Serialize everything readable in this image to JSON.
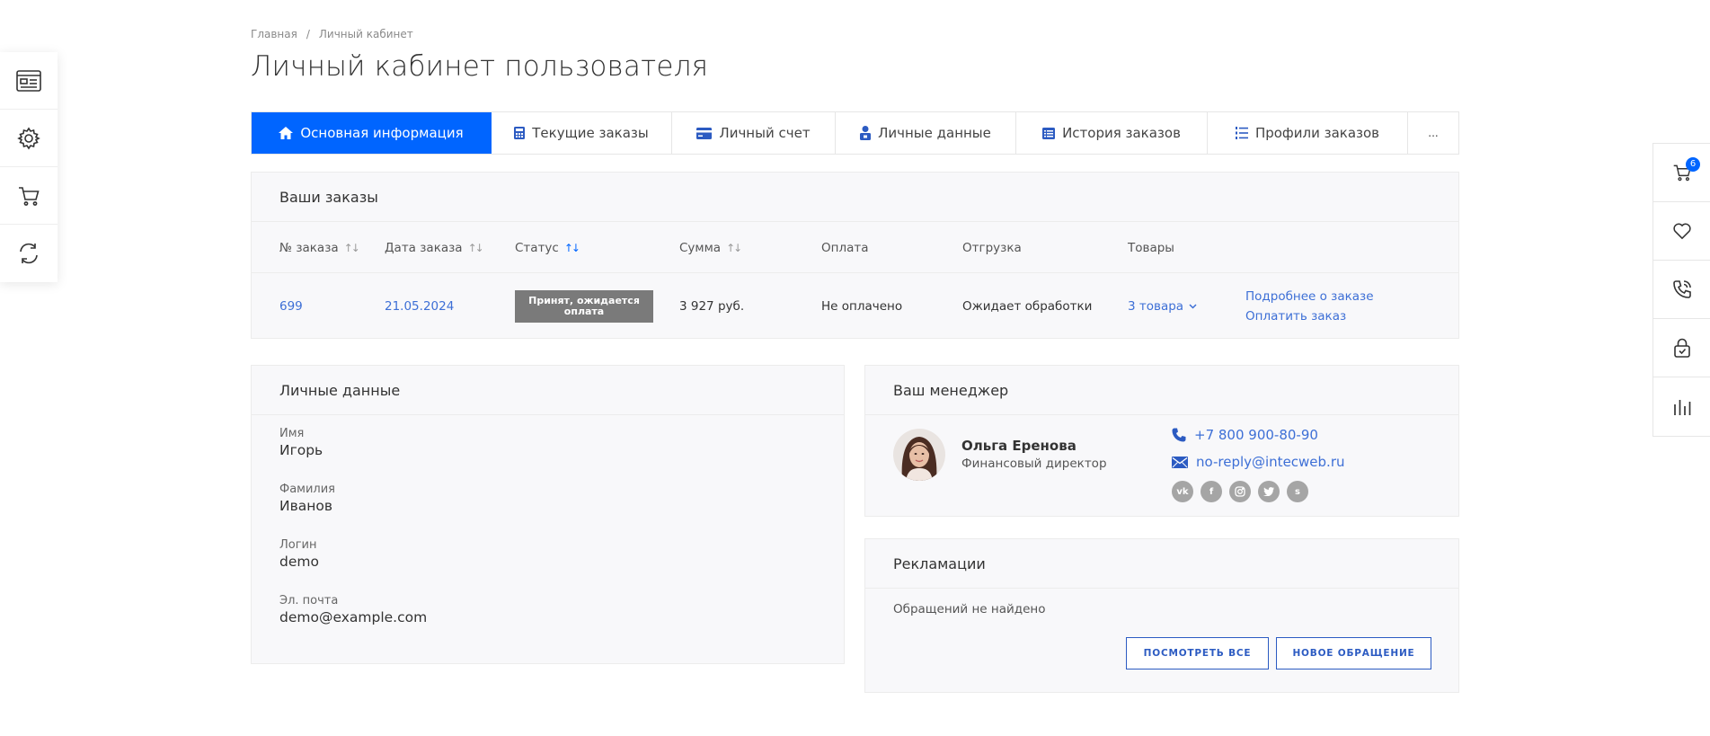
{
  "breadcrumb": {
    "home": "Главная",
    "separator": "/",
    "current": "Личный кабинет"
  },
  "page_title": "Личный кабинет пользователя",
  "tabs": [
    {
      "label": "Основная информация",
      "icon": "home-icon",
      "active": true
    },
    {
      "label": "Текущие заказы",
      "icon": "calculator-icon",
      "active": false
    },
    {
      "label": "Личный счет",
      "icon": "credit-card-icon",
      "active": false
    },
    {
      "label": "Личные данные",
      "icon": "user-lock-icon",
      "active": false
    },
    {
      "label": "История заказов",
      "icon": "list-alt-icon",
      "active": false
    },
    {
      "label": "Профили заказов",
      "icon": "list-ol-icon",
      "active": false
    },
    {
      "label": "...",
      "icon": "more-icon",
      "active": false
    }
  ],
  "orders": {
    "title": "Ваши заказы",
    "columns": {
      "number": "№ заказа",
      "date": "Дата заказа",
      "status": "Статус",
      "sum": "Сумма",
      "payment": "Оплата",
      "shipment": "Отгрузка",
      "goods": "Товары"
    },
    "rows": [
      {
        "number": "699",
        "date": "21.05.2024",
        "status": "Принят, ожидается оплата",
        "sum": "3 927 руб.",
        "payment": "Не оплачено",
        "shipment": "Ожидает обработки",
        "goods": "3 товара",
        "details_link": "Подробнее о заказе",
        "pay_link": "Оплатить заказ"
      }
    ]
  },
  "personal": {
    "title": "Личные данные",
    "fields": [
      {
        "label": "Имя",
        "value": "Игорь"
      },
      {
        "label": "Фамилия",
        "value": "Иванов"
      },
      {
        "label": "Логин",
        "value": "demo"
      },
      {
        "label": "Эл. почта",
        "value": "demo@example.com"
      }
    ]
  },
  "manager": {
    "title": "Ваш менеджер",
    "name": "Ольга Еренова",
    "role": "Финансовый директор",
    "phone": "+7 800 900-80-90",
    "email": "no-reply@intecweb.ru",
    "socials": [
      "vk",
      "f",
      "ig",
      "tw",
      "s"
    ]
  },
  "claims": {
    "title": "Рекламации",
    "empty_text": "Обращений не найдено",
    "view_all": "ПОСМОТРЕТЬ ВСЕ",
    "new_request": "НОВОЕ ОБРАЩЕНИЕ"
  },
  "cart_count": "6",
  "colors": {
    "accent": "#0065ff",
    "link": "#3d6fd6",
    "button": "#2c5bc2",
    "status_badge": "#7a7a7a",
    "panel_bg": "#f8f8fa"
  }
}
